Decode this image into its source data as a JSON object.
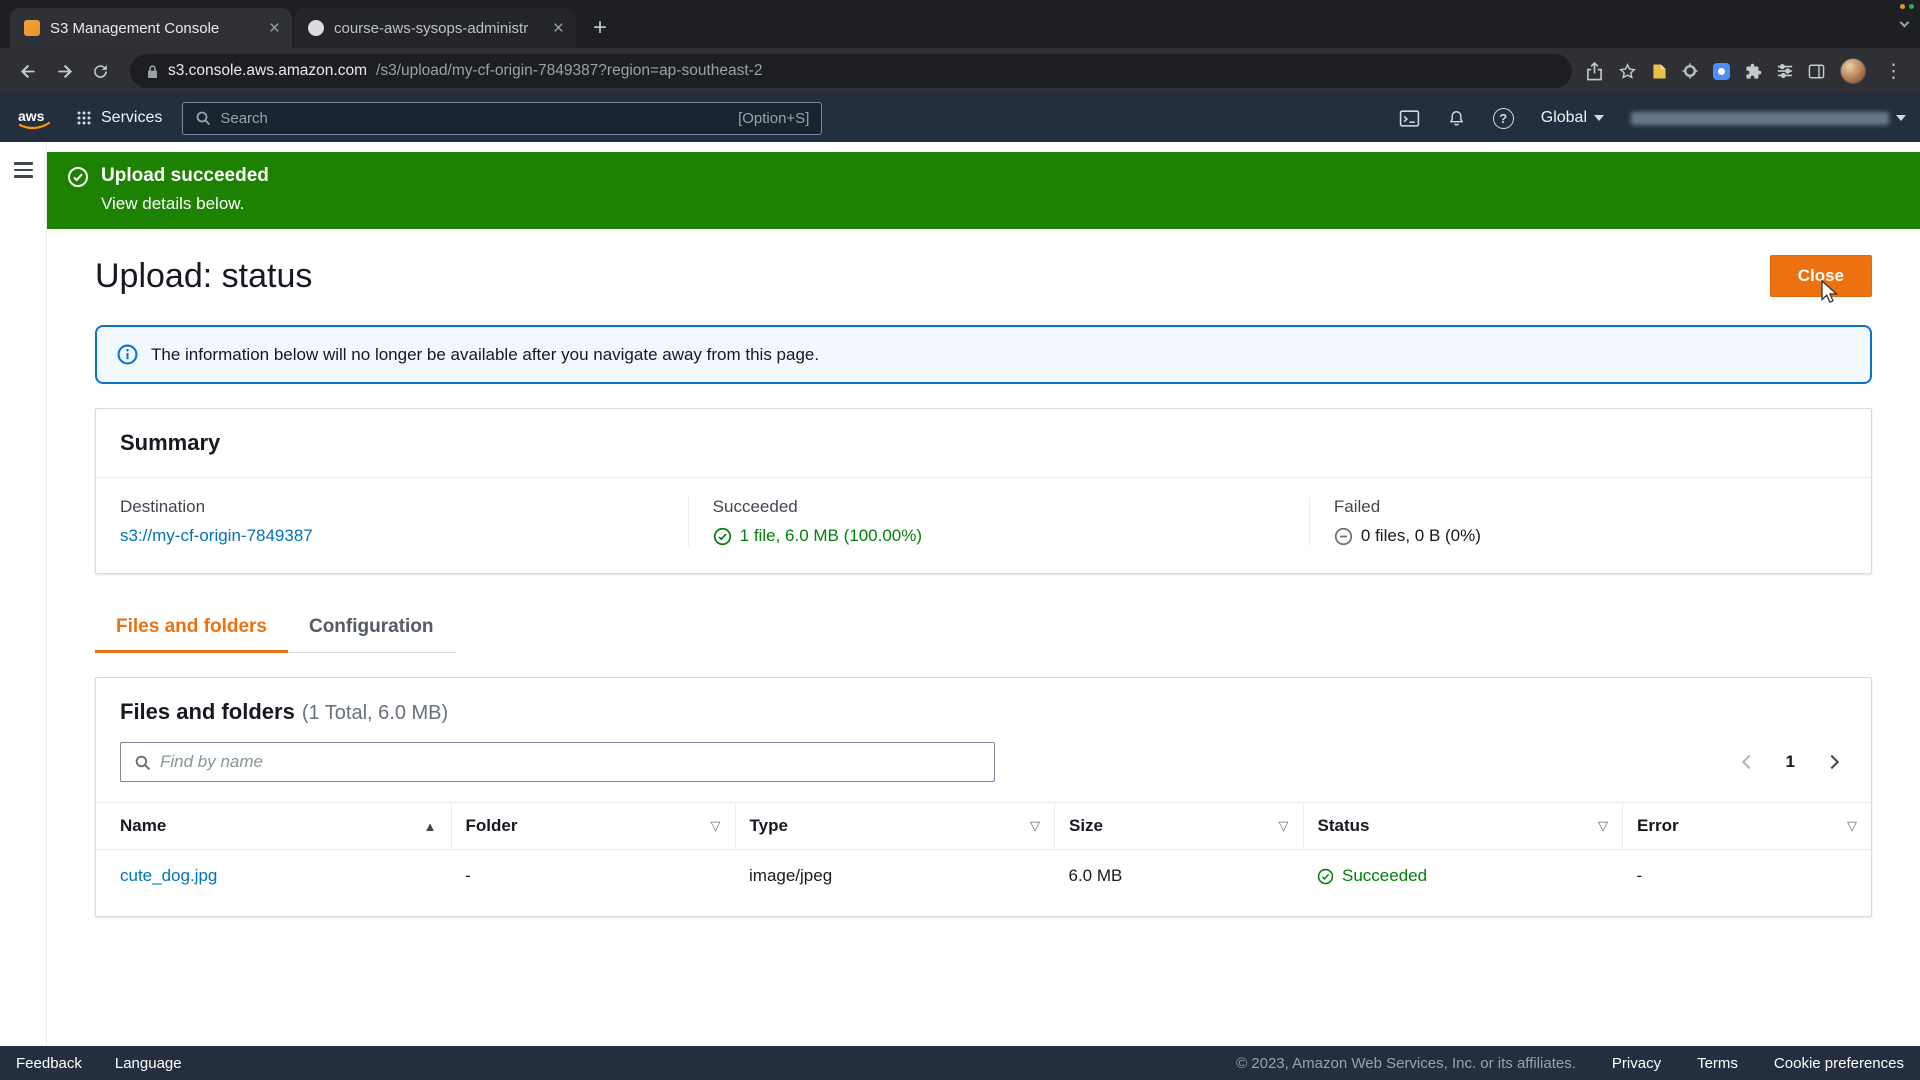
{
  "browser": {
    "tab1": {
      "title": "S3 Management Console"
    },
    "tab2": {
      "title": "course-aws-sysops-administr"
    },
    "url_host": "s3.console.aws.amazon.com",
    "url_path": "/s3/upload/my-cf-origin-7849387?region=ap-southeast-2"
  },
  "nav": {
    "services": "Services",
    "search_placeholder": "Search",
    "search_shortcut": "[Option+S]",
    "region": "Global"
  },
  "banner": {
    "title": "Upload succeeded",
    "subtitle": "View details below."
  },
  "page": {
    "title": "Upload: status",
    "close": "Close",
    "info": "The information below will no longer be available after you navigate away from this page."
  },
  "summary": {
    "heading": "Summary",
    "destination": {
      "label": "Destination",
      "value": "s3://my-cf-origin-7849387"
    },
    "succeeded": {
      "label": "Succeeded",
      "value": "1 file, 6.0 MB (100.00%)"
    },
    "failed": {
      "label": "Failed",
      "value": "0 files, 0 B (0%)"
    }
  },
  "tabs": {
    "files": "Files and folders",
    "config": "Configuration"
  },
  "files": {
    "heading": "Files and folders",
    "meta": "(1 Total, 6.0 MB)",
    "find_placeholder": "Find by name",
    "page": "1",
    "columns": {
      "name": "Name",
      "folder": "Folder",
      "type": "Type",
      "size": "Size",
      "status": "Status",
      "error": "Error"
    },
    "row": {
      "name": "cute_dog.jpg",
      "folder": "-",
      "type": "image/jpeg",
      "size": "6.0 MB",
      "status": "Succeeded",
      "error": "-"
    }
  },
  "footer": {
    "feedback": "Feedback",
    "language": "Language",
    "copyright": "© 2023, Amazon Web Services, Inc. or its affiliates.",
    "privacy": "Privacy",
    "terms": "Terms",
    "cookies": "Cookie preferences"
  },
  "colors": {
    "aws_orange": "#ec7211",
    "banner_green": "#1d8102",
    "success_green": "#037f0c",
    "link_blue": "#0073bb",
    "info_blue": "#0972d3",
    "nav_navy": "#232f3e"
  }
}
